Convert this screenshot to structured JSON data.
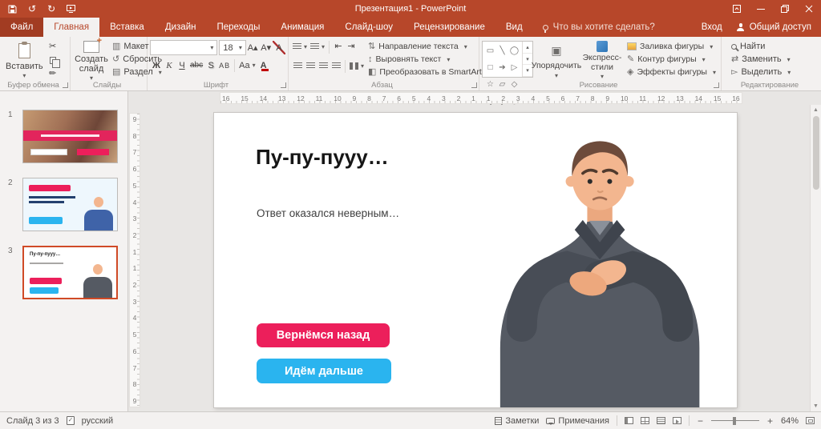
{
  "window": {
    "title": "Презентация1 - PowerPoint"
  },
  "tabs": [
    "Файл",
    "Главная",
    "Вставка",
    "Дизайн",
    "Переходы",
    "Анимация",
    "Слайд-шоу",
    "Рецензирование",
    "Вид"
  ],
  "tellme": "Что вы хотите сделать?",
  "account": {
    "signin": "Вход",
    "share": "Общий доступ"
  },
  "icons": {
    "undo": "↺",
    "repeat": "↻",
    "cut": "✂",
    "format_painter": "✏",
    "layout": "▥",
    "reset_slide": "↺",
    "section": "▤",
    "grow_font": "А▴",
    "shrink_font": "А▾",
    "clear_format": "А",
    "indent_dec": "⇤",
    "indent_inc": "⇥",
    "line_spacing": "↕",
    "direction": "⇅",
    "align_vertical": "↕",
    "smartart": "◧",
    "arrange": "▣",
    "outline_pencil": "✎",
    "effects": "◈",
    "replace": "⇄",
    "select": "▻",
    "gallery_up": "▴",
    "gallery_down": "▾",
    "gallery_more": "▾",
    "zoom_out": "−",
    "zoom_in": "+"
  },
  "ribbon": {
    "clipboard": {
      "group": "Буфер обмена",
      "paste": "Вставить"
    },
    "slides": {
      "group": "Слайды",
      "new_slide": "Создать слайд",
      "layout": "Макет",
      "reset": "Сбросить",
      "section": "Раздел"
    },
    "font": {
      "group": "Шрифт",
      "font_name": "",
      "font_size": "18",
      "bold": "Ж",
      "italic": "К",
      "underline": "Ч",
      "strike": "abc",
      "shadow": "S",
      "spacing": "АВ",
      "case_btn": "Aa",
      "color": "А"
    },
    "paragraph": {
      "group": "Абзац",
      "direction": "Направление текста",
      "align_text": "Выровнять текст",
      "smartart": "Преобразовать в SmartArt"
    },
    "drawing": {
      "group": "Рисование",
      "arrange": "Упорядочить",
      "styles": "Экспресс-стили",
      "fill": "Заливка фигуры",
      "outline": "Контур фигуры",
      "effects": "Эффекты фигуры",
      "shapes": [
        "▭",
        "╲",
        "◯",
        "□",
        "➔",
        "▷",
        "☆",
        "▱",
        "◇",
        "{",
        "}",
        "◡"
      ]
    },
    "editing": {
      "group": "Редактирование",
      "find": "Найти",
      "replace": "Заменить",
      "select": "Выделить"
    }
  },
  "thumbnails": [
    {
      "number": "1"
    },
    {
      "number": "2"
    },
    {
      "number": "3",
      "title": "Пу-пу-пууу…"
    }
  ],
  "rulers": {
    "h": [
      "16",
      "15",
      "14",
      "13",
      "12",
      "11",
      "10",
      "9",
      "8",
      "7",
      "6",
      "5",
      "4",
      "3",
      "2",
      "1",
      "1",
      "2",
      "3",
      "4",
      "5",
      "6",
      "7",
      "8",
      "9",
      "10",
      "11",
      "12",
      "13",
      "14",
      "15",
      "16"
    ],
    "v": [
      "9",
      "8",
      "7",
      "6",
      "5",
      "4",
      "3",
      "2",
      "1",
      "1",
      "2",
      "3",
      "4",
      "5",
      "6",
      "7",
      "8",
      "9"
    ]
  },
  "slide": {
    "title": "Пу-пу-пууу…",
    "body": "Ответ оказался неверным…",
    "button_back": "Вернёмся назад",
    "button_next": "Идём дальше",
    "accent_pink": "#ec1f5b",
    "accent_blue": "#2ab4ef"
  },
  "statusbar": {
    "slide_info": "Слайд 3 из 3",
    "language": "русский",
    "notes": "Заметки",
    "comments": "Примечания",
    "zoom": "64%"
  }
}
